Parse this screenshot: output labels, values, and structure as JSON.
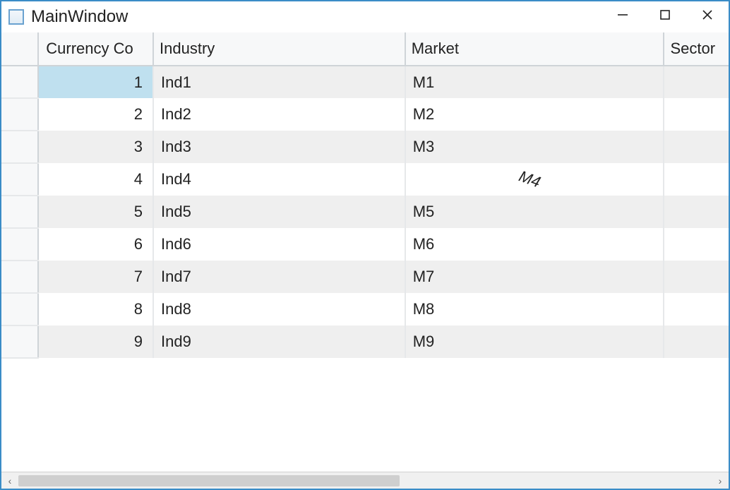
{
  "window": {
    "title": "MainWindow"
  },
  "grid": {
    "columns": {
      "currency": "Currency Co",
      "industry": "Industry",
      "market": "Market",
      "sector": "Sector"
    },
    "rows": [
      {
        "currency": "1",
        "industry": "Ind1",
        "market": "M1",
        "sector": "",
        "selected": true,
        "rotated": false
      },
      {
        "currency": "2",
        "industry": "Ind2",
        "market": "M2",
        "sector": "",
        "selected": false,
        "rotated": false
      },
      {
        "currency": "3",
        "industry": "Ind3",
        "market": "M3",
        "sector": "",
        "selected": false,
        "rotated": false
      },
      {
        "currency": "4",
        "industry": "Ind4",
        "market": "M4",
        "sector": "",
        "selected": false,
        "rotated": true
      },
      {
        "currency": "5",
        "industry": "Ind5",
        "market": "M5",
        "sector": "",
        "selected": false,
        "rotated": false
      },
      {
        "currency": "6",
        "industry": "Ind6",
        "market": "M6",
        "sector": "",
        "selected": false,
        "rotated": false
      },
      {
        "currency": "7",
        "industry": "Ind7",
        "market": "M7",
        "sector": "",
        "selected": false,
        "rotated": false
      },
      {
        "currency": "8",
        "industry": "Ind8",
        "market": "M8",
        "sector": "",
        "selected": false,
        "rotated": false
      },
      {
        "currency": "9",
        "industry": "Ind9",
        "market": "M9",
        "sector": "",
        "selected": false,
        "rotated": false
      }
    ]
  }
}
